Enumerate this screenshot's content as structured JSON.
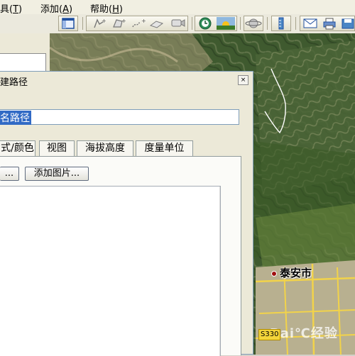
{
  "menubar": {
    "items": [
      {
        "text": "具(",
        "key": "T",
        "close": ")"
      },
      {
        "text": "添加(",
        "key": "A",
        "close": ")"
      },
      {
        "text": "帮助(",
        "key": "H",
        "close": ")"
      }
    ]
  },
  "toolbar": {
    "icons": [
      "sidebar-toggle-icon",
      "add-placemark-icon",
      "add-polygon-icon",
      "add-path-icon",
      "add-overlay-icon",
      "record-tour-icon",
      "historical-imagery-icon",
      "sunlight-icon",
      "switch-planet-icon",
      "ruler-icon",
      "email-icon",
      "print-icon",
      "save-image-icon"
    ]
  },
  "dialog": {
    "title": "建路径",
    "close_glyph": "×",
    "name_value": "名路径",
    "tabs": [
      "式/颜色",
      "视图",
      "海拔高度",
      "度量单位"
    ],
    "buttons": [
      "...",
      "添加图片..."
    ]
  },
  "map": {
    "city_label": "泰安市",
    "road_shield": "S330",
    "watermark": "Bai℃经验"
  },
  "colors": {
    "menubar_bg": "#f1efe2",
    "selection": "#316ac5",
    "window_bg": "#ece9d8",
    "road": "#f2d34a"
  }
}
